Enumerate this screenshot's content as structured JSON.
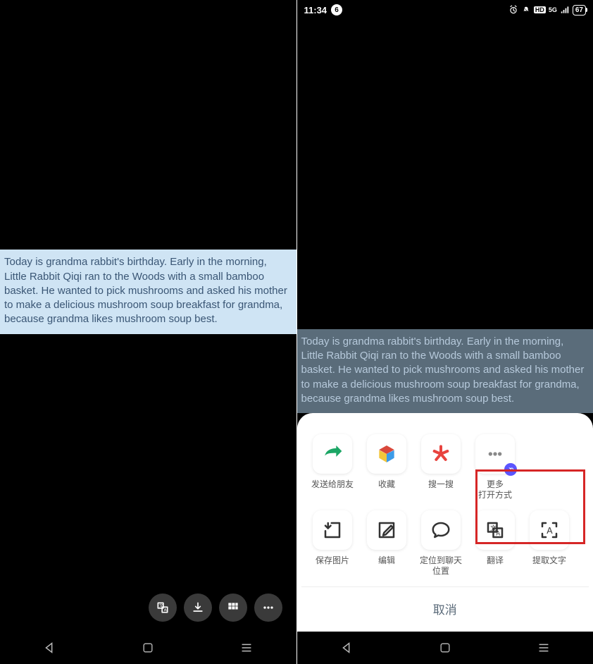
{
  "status": {
    "time": "11:34",
    "badge": "6",
    "battery": "67",
    "hd": "HD",
    "signal_label": "5G"
  },
  "story": {
    "text": "Today is grandma rabbit's birthday. Early in the morning, Little Rabbit Qiqi ran to the Woods with a small bamboo basket. He wanted to pick mushrooms and asked his mother to make a delicious mushroom soup breakfast for grandma, because grandma likes mushroom soup best."
  },
  "left_tray": {
    "translate_btn": "translate",
    "download_btn": "download",
    "grid_btn": "grid",
    "more_btn": "more"
  },
  "sheet": {
    "row1": [
      {
        "key": "send",
        "label": "发送给朋友"
      },
      {
        "key": "fav",
        "label": "收藏"
      },
      {
        "key": "search",
        "label": "搜一搜"
      },
      {
        "key": "more",
        "label": "更多\n打开方式"
      }
    ],
    "row2": [
      {
        "key": "save",
        "label": "保存图片"
      },
      {
        "key": "edit",
        "label": "编辑"
      },
      {
        "key": "locate",
        "label": "定位到聊天\n位置"
      },
      {
        "key": "translate",
        "label": "翻译"
      },
      {
        "key": "extract",
        "label": "提取文字"
      }
    ],
    "cancel": "取消"
  }
}
